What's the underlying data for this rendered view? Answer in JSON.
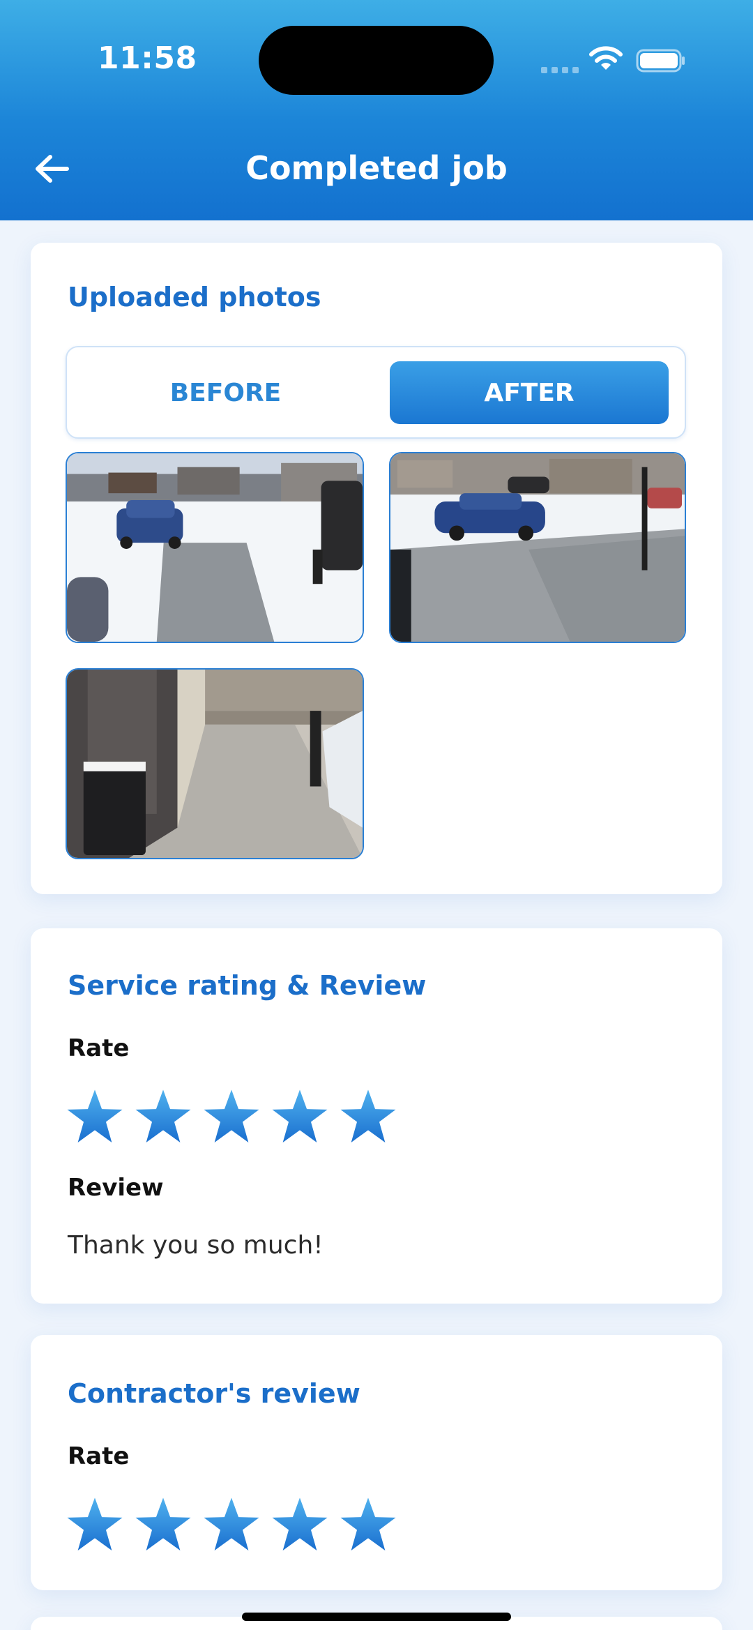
{
  "status_bar": {
    "time": "11:58"
  },
  "header": {
    "title": "Completed job"
  },
  "photos": {
    "section_title": "Uploaded photos",
    "tabs": {
      "before": "BEFORE",
      "after": "AFTER",
      "selected": "AFTER"
    },
    "items": [
      "driveway-photo",
      "driveway-photo",
      "walkway-photo"
    ]
  },
  "service_review": {
    "section_title": "Service rating  & Review",
    "rate_label": "Rate",
    "rating": 5,
    "review_label": "Review",
    "review_text": "Thank you so much!"
  },
  "contractor_review": {
    "section_title": "Contractor's review",
    "rate_label": "Rate",
    "rating": 5
  },
  "colors": {
    "accent": "#1b6ec9",
    "header_top": "#3eaee6",
    "header_bottom": "#1371cf",
    "star": "#2a8ee0"
  }
}
